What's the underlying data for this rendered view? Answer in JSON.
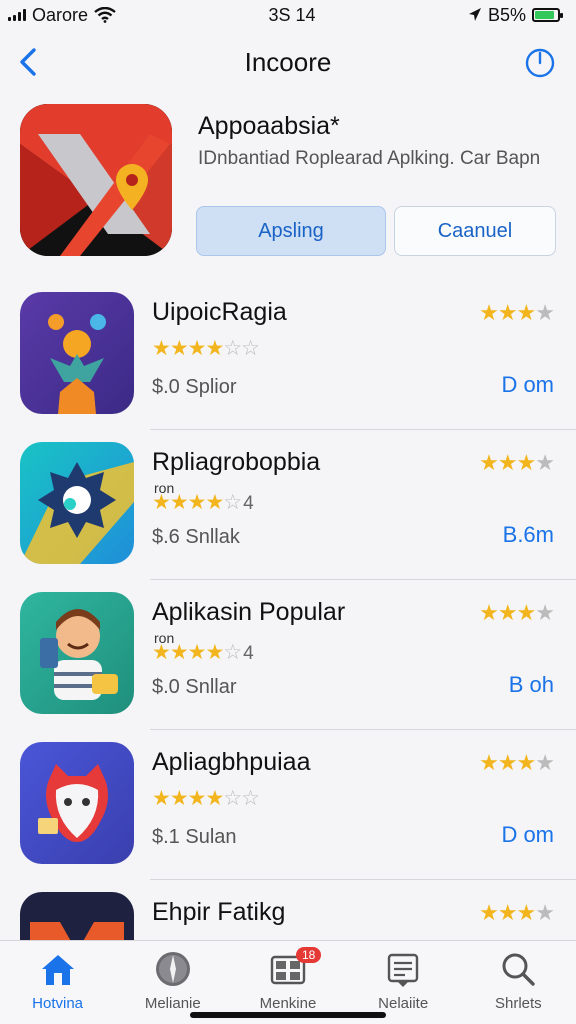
{
  "status": {
    "carrier": "Oarore",
    "time": "3S 14",
    "battery_text": "B5%",
    "battery_level": 0.85,
    "icons": [
      "signal-icon",
      "wifi-icon",
      "location-icon",
      "battery-icon"
    ]
  },
  "nav": {
    "title": "Incoore",
    "back_icon": "chevron-left-icon",
    "action_icon": "power-icon"
  },
  "featured": {
    "title": "Appoaabsia*",
    "description": "IDnbantiad Roplearad Aplking. Car Bapn",
    "primary_button": "Apsling",
    "secondary_button": "Caanuel"
  },
  "apps": [
    {
      "name": "UipoicRagia",
      "sub": "",
      "stars": "★★★★",
      "stars_empty": "☆☆",
      "stars_suffix": "",
      "price": "$.0 Splior",
      "rating": "★★★",
      "rating_empty": "★",
      "size": "D om"
    },
    {
      "name": "Rpliagrobopbia",
      "sub": "ron",
      "stars": "★★★★",
      "stars_empty": "☆",
      "stars_suffix": "4",
      "price": "$.6 Snllak",
      "rating": "★★★",
      "rating_empty": "★",
      "size": "B.6m"
    },
    {
      "name": "Aplikasin Popular",
      "sub": "ron",
      "stars": "★★★★",
      "stars_empty": "☆",
      "stars_suffix": "4",
      "price": "$.0 Snllar",
      "rating": "★★★",
      "rating_empty": "★",
      "size": "B oh"
    },
    {
      "name": "Apliagbhpuiaa",
      "sub": "",
      "stars": "★★★★",
      "stars_empty": "☆☆",
      "stars_suffix": "",
      "price": "$.1 Sulan",
      "rating": "★★★",
      "rating_empty": "★",
      "size": "D om"
    },
    {
      "name": "Ehpir Fatikg",
      "sub": "",
      "stars": "",
      "stars_empty": "",
      "stars_suffix": "",
      "price": "",
      "rating": "★★★",
      "rating_empty": "★",
      "size": ""
    }
  ],
  "tabs": [
    {
      "label": "Hotvina",
      "icon": "home-icon",
      "active": true
    },
    {
      "label": "Melianie",
      "icon": "compass-icon",
      "active": false
    },
    {
      "label": "Menkine",
      "icon": "grid-icon",
      "badge": "18",
      "active": false
    },
    {
      "label": "Nelaiite",
      "icon": "document-icon",
      "active": false
    },
    {
      "label": "Shrlets",
      "icon": "search-icon",
      "active": false
    }
  ],
  "colors": {
    "accent": "#1a73e8",
    "star": "#f2b51d",
    "badge": "#e53935",
    "battery": "#34c759"
  }
}
